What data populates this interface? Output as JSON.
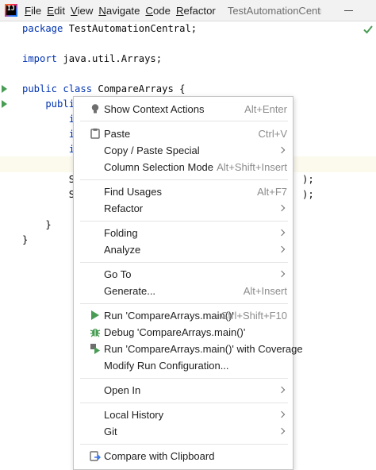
{
  "app": {
    "logo_text": "IJ",
    "project_title": "TestAutomationCentral"
  },
  "menubar": {
    "items": [
      {
        "underline": "F",
        "rest": "ile"
      },
      {
        "underline": "E",
        "rest": "dit"
      },
      {
        "underline": "V",
        "rest": "iew"
      },
      {
        "underline": "N",
        "rest": "avigate"
      },
      {
        "underline": "C",
        "rest": "ode"
      },
      {
        "underline": "R",
        "rest": "efactor"
      }
    ]
  },
  "editor": {
    "lines": [
      {
        "kw": "package",
        "text": " TestAutomationCentral;"
      },
      {
        "kw": "",
        "text": ""
      },
      {
        "kw": "import",
        "text": " java.util.Arrays;"
      },
      {
        "kw": "",
        "text": ""
      },
      {
        "kw": "public class",
        "text": " CompareArrays {"
      },
      {
        "kw": "    publi",
        "text": ""
      },
      {
        "kw": "",
        "text": "        i"
      },
      {
        "kw": "",
        "text": "        i"
      },
      {
        "kw": "",
        "text": "        i"
      },
      {
        "kw": "",
        "text": ""
      },
      {
        "kw": "",
        "text": "        S"
      },
      {
        "kw": "",
        "text": "        S"
      },
      {
        "kw": "",
        "text": ""
      },
      {
        "kw": "",
        "text": ""
      },
      {
        "kw": "",
        "text": "    }"
      },
      {
        "kw": "",
        "text": "}"
      }
    ],
    "right_fragments": [
      ");",
      ");"
    ]
  },
  "context_menu": {
    "items": [
      {
        "label": "Show Context Actions",
        "shortcut": "Alt+Enter",
        "icon": "lightbulb-icon"
      },
      {
        "label": "Paste",
        "shortcut": "Ctrl+V",
        "icon": "paste-icon"
      },
      {
        "label": "Copy / Paste Special",
        "submenu": true
      },
      {
        "label": "Column Selection Mode",
        "shortcut": "Alt+Shift+Insert"
      },
      {
        "label": "Find Usages",
        "shortcut": "Alt+F7"
      },
      {
        "label": "Refactor",
        "submenu": true
      },
      {
        "label": "Folding",
        "submenu": true
      },
      {
        "label": "Analyze",
        "submenu": true
      },
      {
        "label": "Go To",
        "submenu": true
      },
      {
        "label": "Generate...",
        "shortcut": "Alt+Insert"
      },
      {
        "label": "Run 'CompareArrays.main()'",
        "shortcut": "Ctrl+Shift+F10",
        "icon": "run-icon"
      },
      {
        "label": "Debug 'CompareArrays.main()'",
        "icon": "debug-icon"
      },
      {
        "label": "Run 'CompareArrays.main()' with Coverage",
        "icon": "coverage-icon"
      },
      {
        "label": "Modify Run Configuration..."
      },
      {
        "label": "Open In",
        "submenu": true
      },
      {
        "label": "Local History",
        "submenu": true
      },
      {
        "label": "Git",
        "submenu": true
      },
      {
        "label": "Compare with Clipboard",
        "icon": "compare-clipboard-icon"
      }
    ]
  },
  "colors": {
    "keyword": "#0033b3",
    "run_green": "#499c54",
    "current_line": "#fcfaed"
  }
}
